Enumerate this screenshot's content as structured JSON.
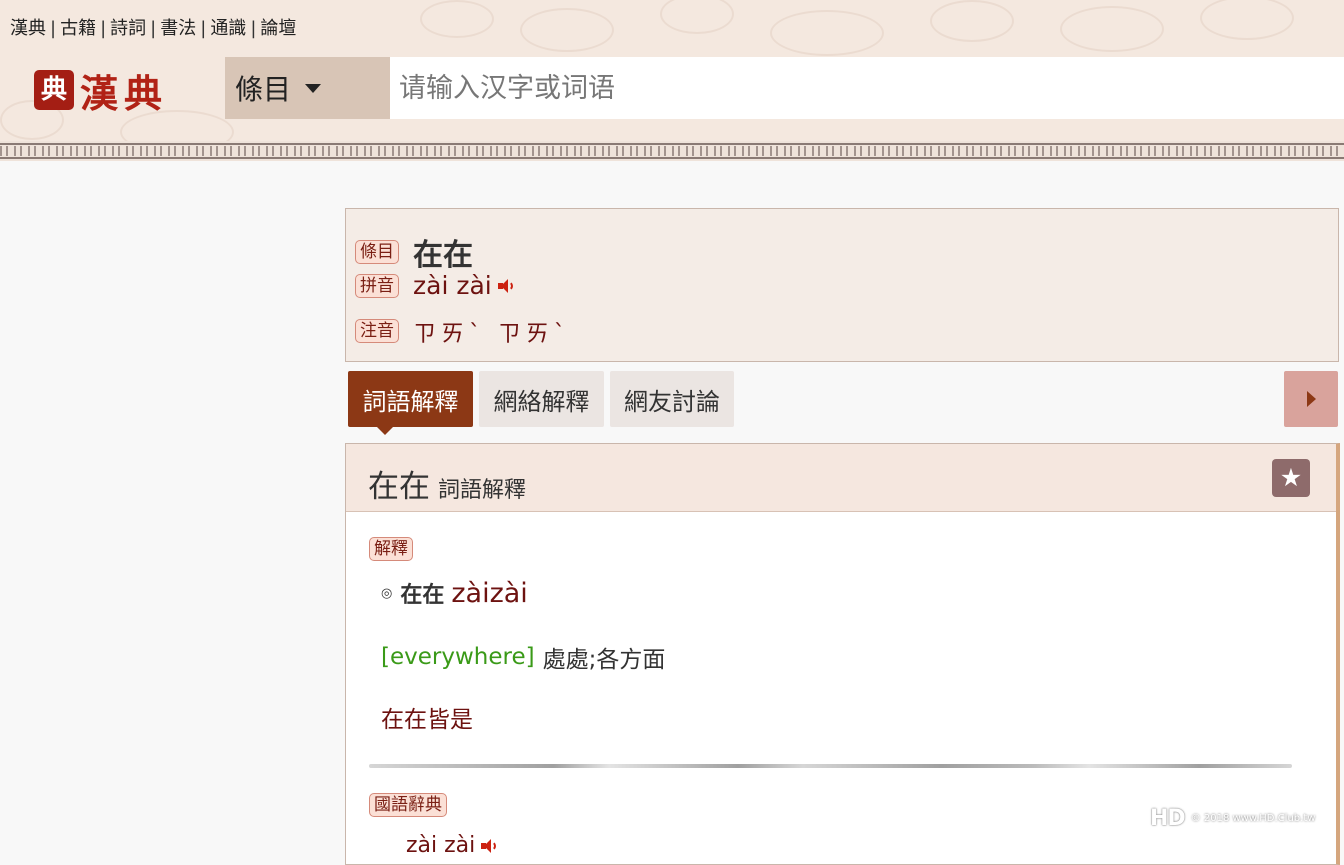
{
  "top_nav": {
    "items": [
      "漢典",
      "古籍",
      "詩詞",
      "書法",
      "通識",
      "論壇"
    ],
    "separator": "|"
  },
  "logo": {
    "seal": "典",
    "text": "漢典"
  },
  "search": {
    "category": "條目",
    "placeholder": "请输入汉字或词语",
    "value": ""
  },
  "entry": {
    "term_label": "條目",
    "term": "在在",
    "pinyin_label": "拼音",
    "pinyin": "zài zài",
    "zhuyin_label": "注音",
    "zhuyin": "ㄗㄞˋ ㄗㄞˋ"
  },
  "tabs": [
    {
      "label": "詞語解釋",
      "active": true
    },
    {
      "label": "網絡解釋",
      "active": false
    },
    {
      "label": "網友討論",
      "active": false
    }
  ],
  "panel": {
    "title_term": "在在",
    "title_sub": "詞語解釋",
    "section1_tag": "解釋",
    "bullet": "◎",
    "def_term": "在在",
    "def_pinyin": "zàizài",
    "def_en": "[everywhere]",
    "def_zh": "處處;各方面",
    "example": "在在皆是",
    "section2_tag": "國語辭典",
    "cut_text": "zài zài"
  },
  "watermark": {
    "logo": "HD",
    "text": "© 2018 www.HD.Club.tw"
  },
  "icons": {
    "search_caret": "caret-down-icon",
    "speaker": "speaker-icon",
    "star": "star-icon",
    "next": "arrow-right-icon"
  },
  "colors": {
    "accent": "#8c3815",
    "brand_red": "#b12216",
    "pinyin": "#6d1210",
    "english": "#3a9a18",
    "header_bg": "#f4e8df"
  }
}
